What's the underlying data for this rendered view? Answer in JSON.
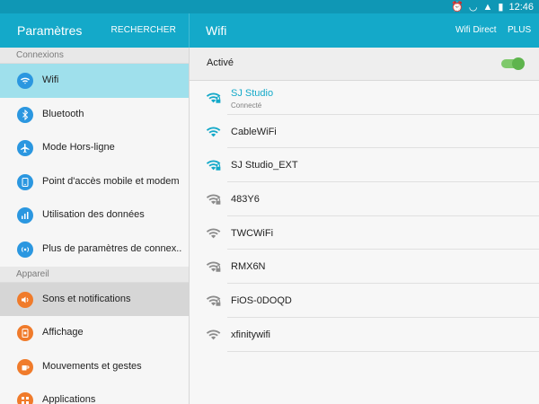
{
  "status_bar": {
    "time": "12:46"
  },
  "header": {
    "left_title": "Paramètres",
    "search_label": "RECHERCHER",
    "right_title": "Wifi",
    "wifi_direct_label": "Wifi Direct",
    "more_label": "PLUS"
  },
  "sidebar": {
    "sections": [
      {
        "header": "Connexions",
        "items": [
          {
            "label": "Wifi",
            "icon": "wifi-icon",
            "state": "selected"
          },
          {
            "label": "Bluetooth",
            "icon": "bluetooth-icon"
          },
          {
            "label": "Mode Hors-ligne",
            "icon": "airplane-icon"
          },
          {
            "label": "Point d'accès mobile et modem",
            "icon": "hotspot-icon"
          },
          {
            "label": "Utilisation des données",
            "icon": "data-usage-icon"
          },
          {
            "label": "Plus de paramètres de connex..",
            "icon": "more-connections-icon"
          }
        ]
      },
      {
        "header": "Appareil",
        "items": [
          {
            "label": "Sons et notifications",
            "icon": "sound-icon",
            "state": "hover"
          },
          {
            "label": "Affichage",
            "icon": "display-icon"
          },
          {
            "label": "Mouvements et gestes",
            "icon": "motion-icon"
          },
          {
            "label": "Applications",
            "icon": "apps-icon"
          }
        ]
      }
    ]
  },
  "main": {
    "toggle_label": "Activé",
    "toggle_on": true,
    "networks": [
      {
        "name": "SJ Studio",
        "status": "Connecté",
        "locked": true,
        "color": "#14a9c9",
        "icon": "wifi-lock-icon"
      },
      {
        "name": "CableWiFi",
        "locked": false,
        "color": "#14a9c9",
        "icon": "wifi-icon"
      },
      {
        "name": "SJ Studio_EXT",
        "locked": true,
        "color": "#14a9c9",
        "icon": "wifi-lock-icon"
      },
      {
        "name": "483Y6",
        "locked": true,
        "color": "#8c8c8c",
        "icon": "wifi-lock-icon"
      },
      {
        "name": "TWCWiFi",
        "locked": false,
        "color": "#8c8c8c",
        "icon": "wifi-icon"
      },
      {
        "name": "RMX6N",
        "locked": true,
        "color": "#8c8c8c",
        "icon": "wifi-lock-icon"
      },
      {
        "name": "FiOS-0DOQD",
        "locked": true,
        "color": "#8c8c8c",
        "icon": "wifi-lock-icon"
      },
      {
        "name": "xfinitywifi",
        "locked": false,
        "color": "#8c8c8c",
        "icon": "wifi-icon"
      }
    ]
  },
  "colors": {
    "status_bar": "#0f97b5",
    "app_bar": "#14a9c9",
    "selected_item": "#9fe0ec",
    "accent": "#14a9c9",
    "toggle": "#5eb44d",
    "icon_blue": "#2b97e0",
    "icon_orange": "#f07b2b"
  }
}
